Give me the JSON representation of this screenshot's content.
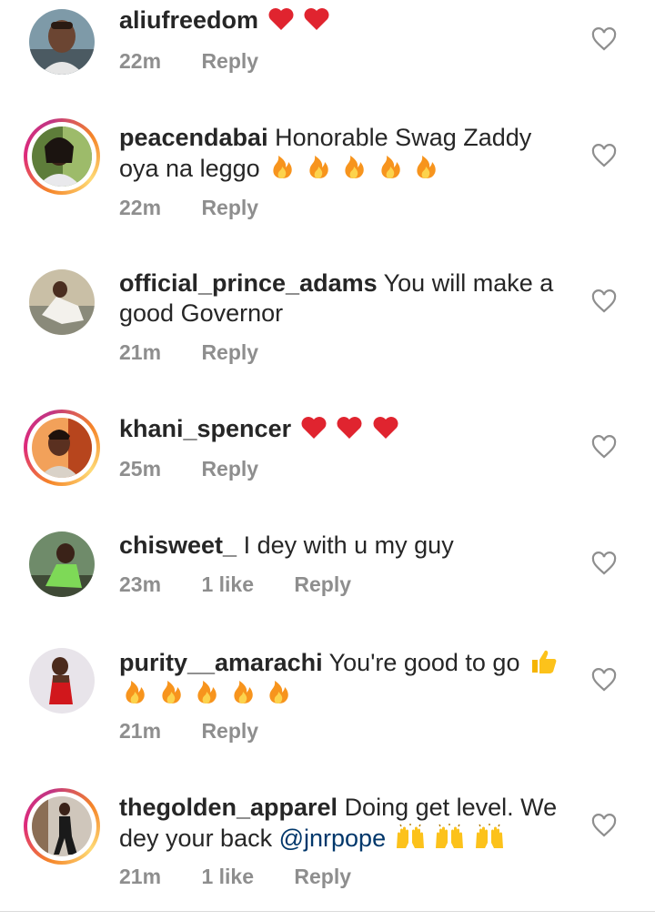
{
  "comments": [
    {
      "username": "aliufreedom",
      "text": "",
      "emojis": [
        "heart",
        "heart"
      ],
      "time": "22m",
      "likes": "",
      "reply": "Reply",
      "story": false
    },
    {
      "username": "peacendabai",
      "text": "Honorable Swag Zaddy oya na leggo",
      "emojis": [
        "fire",
        "fire",
        "fire",
        "fire",
        "fire"
      ],
      "time": "22m",
      "likes": "",
      "reply": "Reply",
      "story": true
    },
    {
      "username": "official_prince_adams",
      "text": "You will make a good Governor",
      "emojis": [],
      "time": "21m",
      "likes": "",
      "reply": "Reply",
      "story": false
    },
    {
      "username": "khani_spencer",
      "text": "",
      "emojis": [
        "heart",
        "heart",
        "heart"
      ],
      "time": "25m",
      "likes": "",
      "reply": "Reply",
      "story": true
    },
    {
      "username": "chisweet_",
      "text": "I dey with u my guy",
      "emojis": [],
      "time": "23m",
      "likes": "1 like",
      "reply": "Reply",
      "story": false
    },
    {
      "username": "purity__amarachi",
      "text": "You're good to go",
      "emojis": [
        "thumbs-up",
        "fire",
        "fire",
        "fire",
        "fire",
        "fire"
      ],
      "time": "21m",
      "likes": "",
      "reply": "Reply",
      "story": false
    },
    {
      "username": "thegolden_apparel",
      "text": "Doing get level. We dey your back",
      "mention": "@jnrpope",
      "emojis": [
        "raised-hands",
        "raised-hands",
        "raised-hands"
      ],
      "time": "21m",
      "likes": "1 like",
      "reply": "Reply",
      "story": true
    }
  ],
  "icons": {
    "like": "heart-outline-icon"
  },
  "colors": {
    "text": "#262626",
    "meta": "#8e8e8e",
    "mention": "#00376b",
    "heart_emoji": "#e0242f",
    "fire_emoji": "#f7941d"
  }
}
